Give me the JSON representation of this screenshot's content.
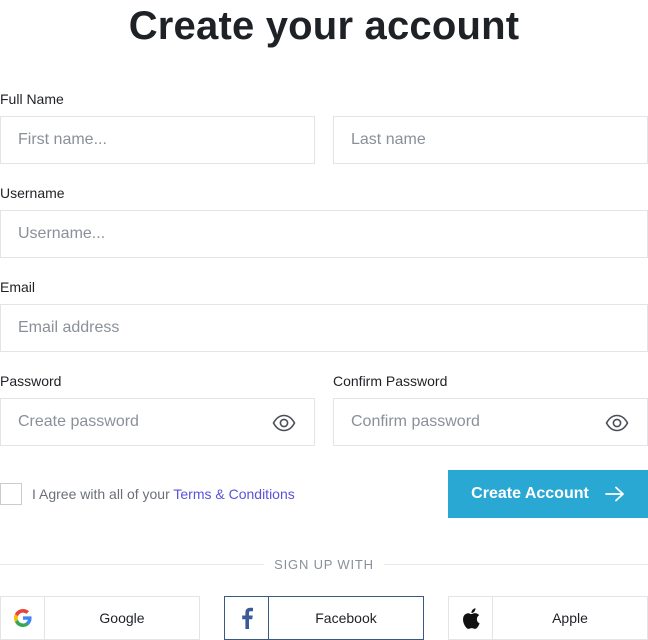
{
  "page": {
    "title": "Create your account"
  },
  "form": {
    "full_name": {
      "label": "Full Name",
      "first_placeholder": "First name...",
      "last_placeholder": "Last name"
    },
    "username": {
      "label": "Username",
      "placeholder": "Username..."
    },
    "email": {
      "label": "Email",
      "placeholder": "Email address"
    },
    "password": {
      "label": "Password",
      "placeholder": "Create password"
    },
    "confirm_password": {
      "label": "Confirm Password",
      "placeholder": "Confirm password"
    },
    "agree": {
      "text": "I Agree with all of your ",
      "link": "Terms & Conditions"
    },
    "submit_label": "Create Account"
  },
  "social": {
    "heading": "SIGN UP WITH",
    "google_label": "Google",
    "facebook_label": "Facebook",
    "apple_label": "Apple"
  },
  "icons": {
    "eye": "eye-icon",
    "arrow": "arrow-right-icon",
    "google": "google-icon",
    "facebook": "facebook-icon",
    "apple": "apple-icon"
  },
  "colors": {
    "accent": "#2aa8d4",
    "link": "#5a53d8",
    "facebook_border": "#3a5a86"
  }
}
